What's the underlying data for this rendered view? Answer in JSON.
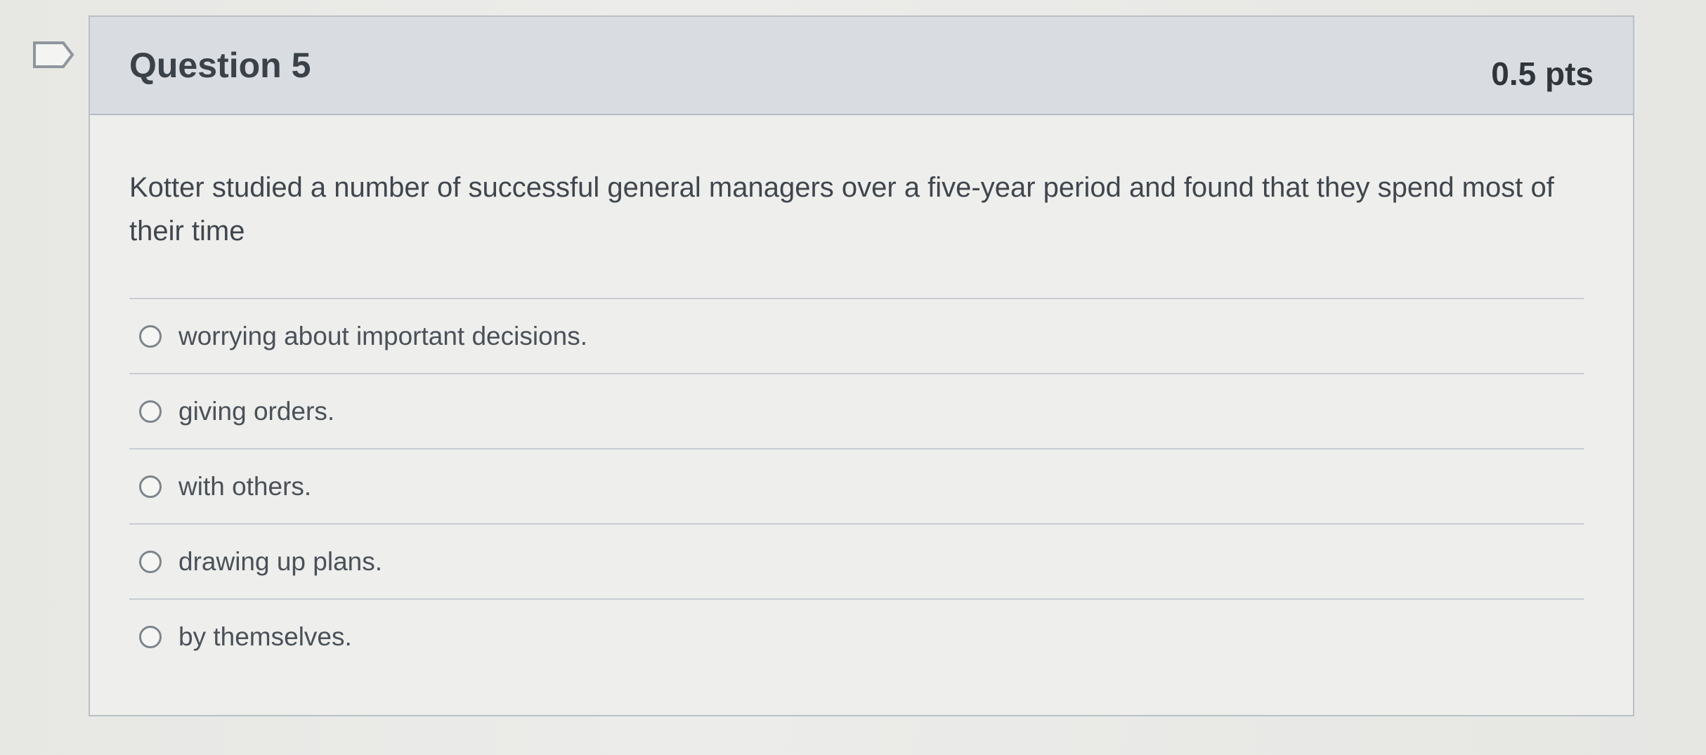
{
  "question": {
    "title": "Question 5",
    "points": "0.5 pts",
    "text": "Kotter studied a number of successful general managers over a five-year period and found that they spend most of their time",
    "answers": [
      "worrying about important decisions.",
      "giving orders.",
      "with others.",
      "drawing up plans.",
      "by themselves."
    ]
  },
  "icons": {
    "flag": "flag-icon"
  }
}
